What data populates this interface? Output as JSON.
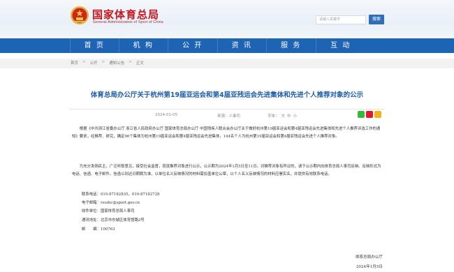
{
  "header": {
    "site_name": "国家体育总局",
    "site_name_en": "General Administration of Sport of China",
    "search_placeholder": "请输入关键字",
    "search_button": "搜索"
  },
  "nav": {
    "items": [
      "首 页",
      "机 构",
      "公 开",
      "资 讯",
      "服 务",
      "互 动"
    ]
  },
  "breadcrumb": {
    "items": [
      "首页",
      "公开",
      "通知公告",
      "正文"
    ],
    "separator": ">"
  },
  "article": {
    "title": "体育总局办公厅关于杭州第19届亚运会和第4届亚残运会先进集体和先进个人推荐对象的公示",
    "date": "2024-01-05",
    "source": "来源：人事司",
    "font_label": "字体：",
    "font_sizes": [
      "大",
      "中",
      "小"
    ],
    "paragraph1": "根据《中共浙江省委办公厅 浙江省人民政府办公厅 国家体育总局办公厅 中国残疾人联合会办公厅关于做好杭州第19届亚运会和第4届亚残运会先进集体和先进个人推荐评选工作的通知》要求，经推荐、研究，确定96个集体为杭州第19届亚运会和第4届亚残运会先进集体，144名个人为杭州第19届亚运会和第4届亚残运会先进个人推荐对象。",
    "paragraph2": "为充分发扬民主，广泛听取意见，接受社会监督，现就推荐对象进行公示，公示期为2024年1月5日至11日。对推荐对象有异议的，请于公示期内向体育总局人事司反映。反映形式为电话、信函、电子邮件。信函以到达日期戳为准，以单位名义反映情况的材料需加盖单位公章，以个人名义反映情况的材料应署实名，并提供有效联系电话。",
    "contacts": [
      "联系电话：010-87182835，010-87182728",
      "电子邮箱：rsszhc@sport.gov.cn",
      "收件单位：国家体育总局人事司",
      "通讯地址：北京市东城区体育馆路2号",
      "邮　　编：100763"
    ],
    "signature_org": "体育总局办公厅",
    "signature_date": "2024年1月5日"
  },
  "colors": {
    "brand_red": "#c8161d",
    "nav_blue": "#1e64b4",
    "title_blue": "#1d5ca8"
  },
  "icons": [
    "national-emblem-icon",
    "wechat-share-icon",
    "weibo-share-icon",
    "qzone-share-icon"
  ]
}
